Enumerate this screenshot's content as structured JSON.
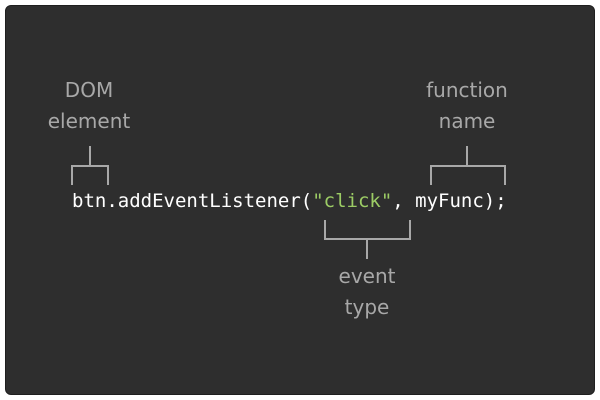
{
  "colors": {
    "background": "#2e2e2e",
    "code_text": "#ffffff",
    "string_literal": "#9ccc65",
    "annotation": "#a8a8a8"
  },
  "code": {
    "prefix": "btn.addEventListener(",
    "string_arg": "\"click\"",
    "suffix": ", myFunc);"
  },
  "annotations": {
    "dom_element": [
      "DOM",
      "element"
    ],
    "function_name": [
      "function",
      "name"
    ],
    "event_type": [
      "event",
      "type"
    ]
  }
}
